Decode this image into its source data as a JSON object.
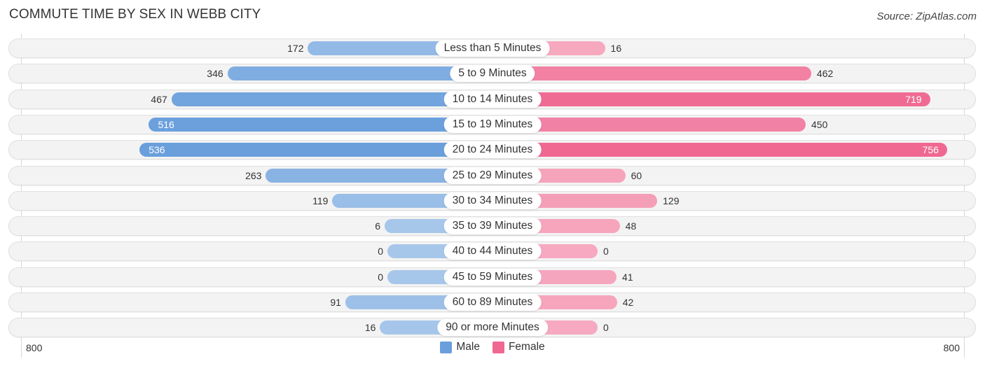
{
  "header": {
    "title": "COMMUTE TIME BY SEX IN WEBB CITY",
    "source": "Source: ZipAtlas.com"
  },
  "colors": {
    "male_strong": "#6a9fdc",
    "male_light": "#a7c7ea",
    "female_strong": "#f06892",
    "female_light": "#f6a9c0",
    "track": "#f3f3f3"
  },
  "chart_data": {
    "type": "bar",
    "orientation": "horizontal-diverging",
    "title": "COMMUTE TIME BY SEX IN WEBB CITY",
    "categories": [
      "Less than 5 Minutes",
      "5 to 9 Minutes",
      "10 to 14 Minutes",
      "15 to 19 Minutes",
      "20 to 24 Minutes",
      "25 to 29 Minutes",
      "30 to 34 Minutes",
      "35 to 39 Minutes",
      "40 to 44 Minutes",
      "45 to 59 Minutes",
      "60 to 89 Minutes",
      "90 or more Minutes"
    ],
    "series": [
      {
        "name": "Male",
        "side": "left",
        "values": [
          172,
          346,
          467,
          516,
          536,
          263,
          119,
          6,
          0,
          0,
          91,
          16
        ]
      },
      {
        "name": "Female",
        "side": "right",
        "values": [
          16,
          462,
          719,
          450,
          756,
          60,
          129,
          48,
          0,
          41,
          42,
          0
        ]
      }
    ],
    "axis": {
      "left_label": "800",
      "right_label": "800",
      "range": [
        0,
        800
      ]
    },
    "legend": {
      "position": "bottom-center",
      "entries": [
        "Male",
        "Female"
      ]
    },
    "grid": false
  }
}
